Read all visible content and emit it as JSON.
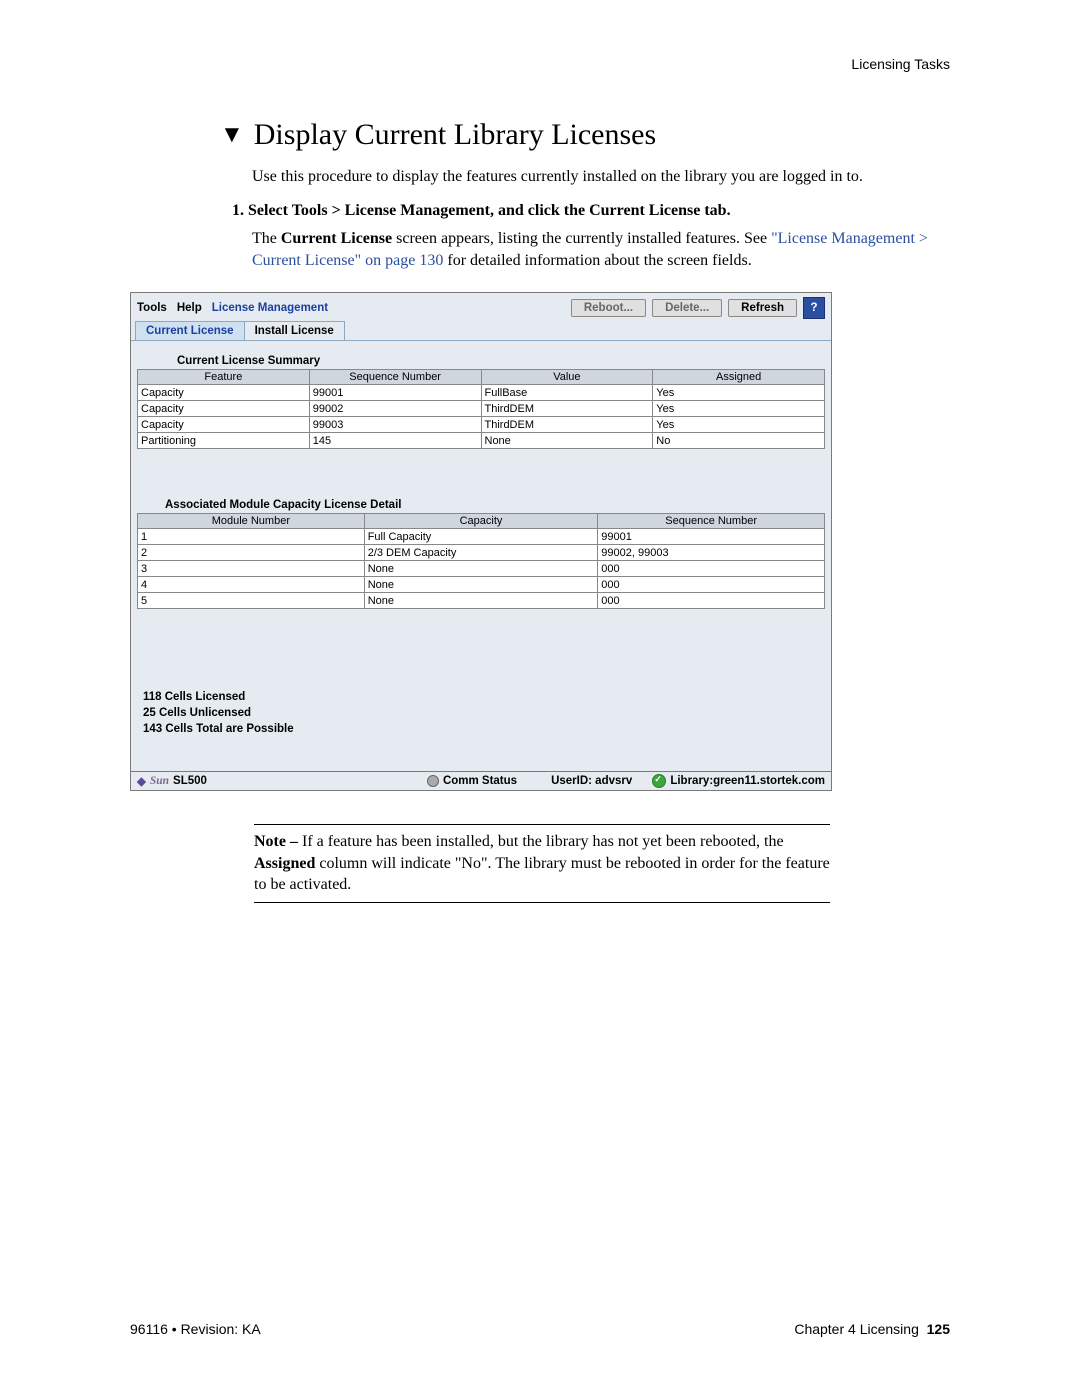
{
  "header": {
    "right": "Licensing Tasks"
  },
  "title": "Display Current Library Licenses",
  "intro": "Use this procedure to display the features currently installed on the library you are logged in to.",
  "step1": "1. Select Tools > License Management, and click the Current License tab.",
  "desc_pre": "The ",
  "desc_bold": "Current License",
  "desc_mid": " screen appears, listing the currently installed features. See ",
  "desc_link": "\"License Management > Current License\" on page 130",
  "desc_post": " for detailed information about the screen fields.",
  "menu": {
    "tools": "Tools",
    "help": "Help",
    "lm": "License Management",
    "reboot": "Reboot...",
    "delete": "Delete...",
    "refresh": "Refresh",
    "help_icon": "?"
  },
  "tabs": {
    "current": "Current License",
    "install": "Install License"
  },
  "summary_title": "Current License Summary",
  "summary_headers": {
    "feature": "Feature",
    "seq": "Sequence Number",
    "value": "Value",
    "assigned": "Assigned"
  },
  "summary_rows": [
    {
      "feature": "Capacity",
      "seq": "99001",
      "value": "FullBase",
      "assigned": "Yes"
    },
    {
      "feature": "Capacity",
      "seq": "99002",
      "value": "ThirdDEM",
      "assigned": "Yes"
    },
    {
      "feature": "Capacity",
      "seq": "99003",
      "value": "ThirdDEM",
      "assigned": "Yes"
    },
    {
      "feature": "Partitioning",
      "seq": "145",
      "value": "None",
      "assigned": "No"
    }
  ],
  "detail_title": "Associated Module Capacity License Detail",
  "detail_headers": {
    "module": "Module Number",
    "capacity": "Capacity",
    "seq": "Sequence Number"
  },
  "detail_rows": [
    {
      "module": "1",
      "capacity": "Full Capacity",
      "seq": "99001"
    },
    {
      "module": "2",
      "capacity": "2/3 DEM Capacity",
      "seq": "99002, 99003"
    },
    {
      "module": "3",
      "capacity": "None",
      "seq": "000"
    },
    {
      "module": "4",
      "capacity": "None",
      "seq": "000"
    },
    {
      "module": "5",
      "capacity": "None",
      "seq": "000"
    }
  ],
  "cells": {
    "licensed": "118 Cells Licensed",
    "unlicensed": "25 Cells Unlicensed",
    "total": "143 Cells Total are Possible"
  },
  "status": {
    "sun": "Sun",
    "model": "SL500",
    "comm": "Comm Status",
    "user_label": "UserID:",
    "user_value": "advsrv",
    "library": "Library:green11.stortek.com"
  },
  "note": {
    "prefix": "Note – ",
    "body1": "If a feature has been installed, but the library has not yet been rebooted, the ",
    "body_bold": "Assigned",
    "body2": " column will indicate \"No\". The library must be rebooted in order for the feature to be activated."
  },
  "footer": {
    "left": "96116 • Revision: KA",
    "right_text": "Chapter 4 Licensing",
    "page": "125"
  }
}
